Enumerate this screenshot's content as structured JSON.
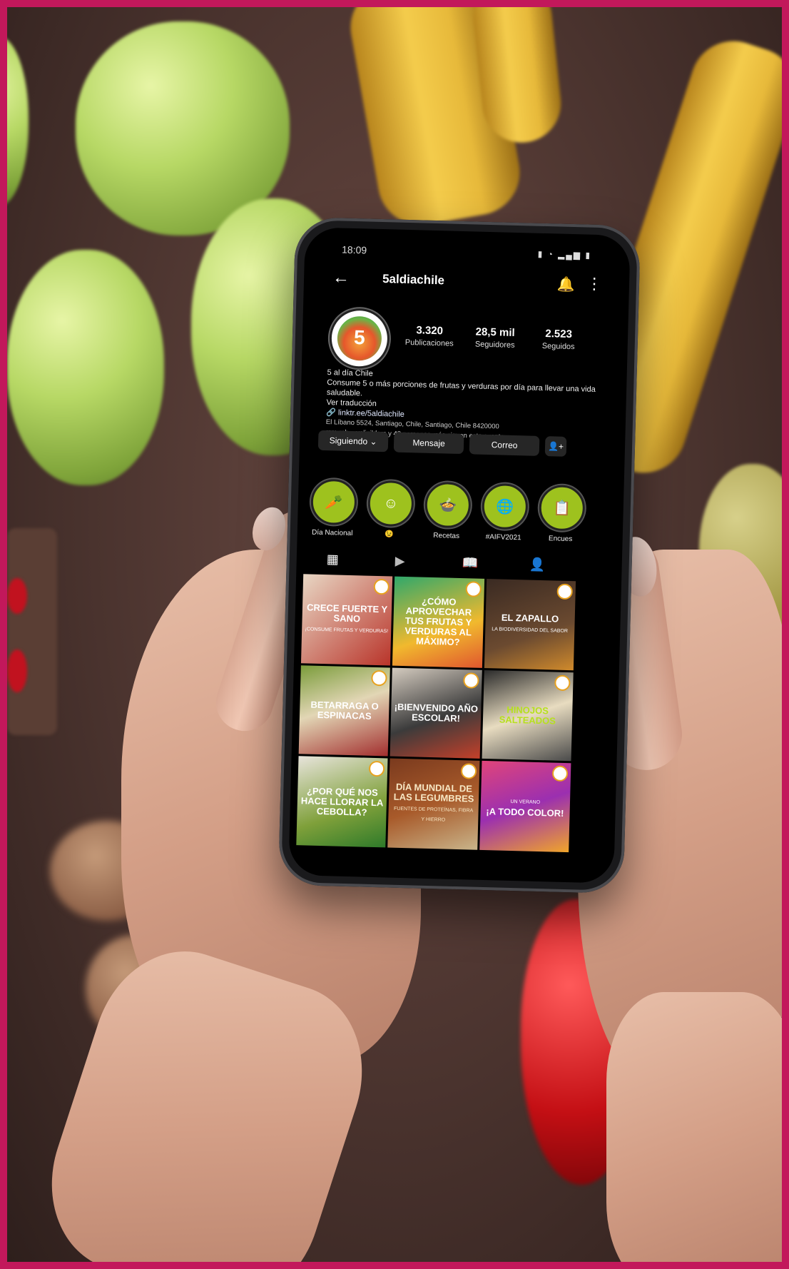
{
  "phone": {
    "status_time": "18:09",
    "username": "5aldiachile",
    "profile": {
      "avatar_text": "5",
      "stats": [
        {
          "value": "3.320",
          "label": "Publicaciones"
        },
        {
          "value": "28,5 mil",
          "label": "Seguidores"
        },
        {
          "value": "2.523",
          "label": "Seguidos"
        }
      ],
      "name": "5 al día Chile",
      "bio": "Consume 5 o más porciones de frutas y verduras por día para llevar una vida saludable.",
      "translate": "Ver traducción",
      "link": "linktr.ee/5aldiachile",
      "address": "El Líbano 5524, Santiago, Chile, Santiago, Chile 8420000",
      "followed_by": "mmrrch_, yeligildom y 42 personas más siguen esta cuenta"
    },
    "buttons": {
      "following": "Siguiendo",
      "message": "Mensaje",
      "email": "Correo"
    },
    "highlights": [
      {
        "label": "Día Nacional"
      },
      {
        "label": "😉"
      },
      {
        "label": "Recetas"
      },
      {
        "label": "#AIFV2021"
      },
      {
        "label": "Encues"
      }
    ],
    "posts": [
      {
        "title": "CRECE FUERTE Y SANO",
        "sub": "¡CONSUME FRUTAS Y VERDURAS!"
      },
      {
        "title": "¿CÓMO APROVECHAR TUS FRUTAS Y VERDURAS AL MÁXIMO?",
        "sub": ""
      },
      {
        "title": "EL ZAPALLO",
        "sub": "LA BIODIVERSIDAD DEL SABOR"
      },
      {
        "title": "BETARRAGA O ESPINACAS",
        "sub": ""
      },
      {
        "title": "¡BIENVENIDO AÑO ESCOLAR!",
        "sub": ""
      },
      {
        "title": "HINOJOS SALTEADOS",
        "sub": ""
      },
      {
        "title": "¿POR QUÉ NOS HACE LLORAR LA CEBOLLA?",
        "sub": ""
      },
      {
        "title": "DÍA MUNDIAL DE LAS LEGUMBRES",
        "sub": "FUENTES DE PROTEÍNAS, FIBRA Y HIERRO"
      },
      {
        "title": "¡A TODO COLOR!",
        "sub": "UN VERANO"
      }
    ]
  }
}
